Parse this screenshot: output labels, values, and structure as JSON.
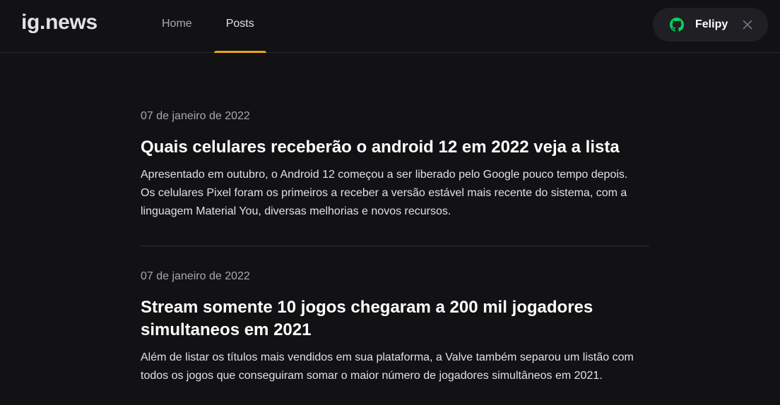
{
  "header": {
    "logo": "ig.news",
    "nav": [
      {
        "label": "Home",
        "active": false
      },
      {
        "label": "Posts",
        "active": true
      }
    ],
    "user": {
      "name": "Felipy",
      "icon": "github-icon",
      "close_icon": "close-icon"
    }
  },
  "posts": [
    {
      "date": "07 de janeiro de 2022",
      "title": "Quais celulares receberão o android 12 em 2022 veja a lista",
      "excerpt": "Apresentado em outubro, o Android 12 começou a ser liberado pelo Google pouco tempo depois. Os celulares Pixel foram os primeiros a receber a versão estável mais recente do sistema, com a linguagem Material You, diversas melhorias e novos recursos."
    },
    {
      "date": "07 de janeiro de 2022",
      "title": "Stream somente 10 jogos chegaram a 200 mil jogadores simultaneos em 2021",
      "excerpt": "Além de listar os títulos mais vendidos em sua plataforma, a Valve também separou um listão com todos os jogos que conseguiram somar o maior número de jogadores simultâneos em 2021."
    }
  ],
  "colors": {
    "background": "#121214",
    "accent": "#eba417",
    "github_green": "#04d361",
    "chip": "#202024"
  }
}
